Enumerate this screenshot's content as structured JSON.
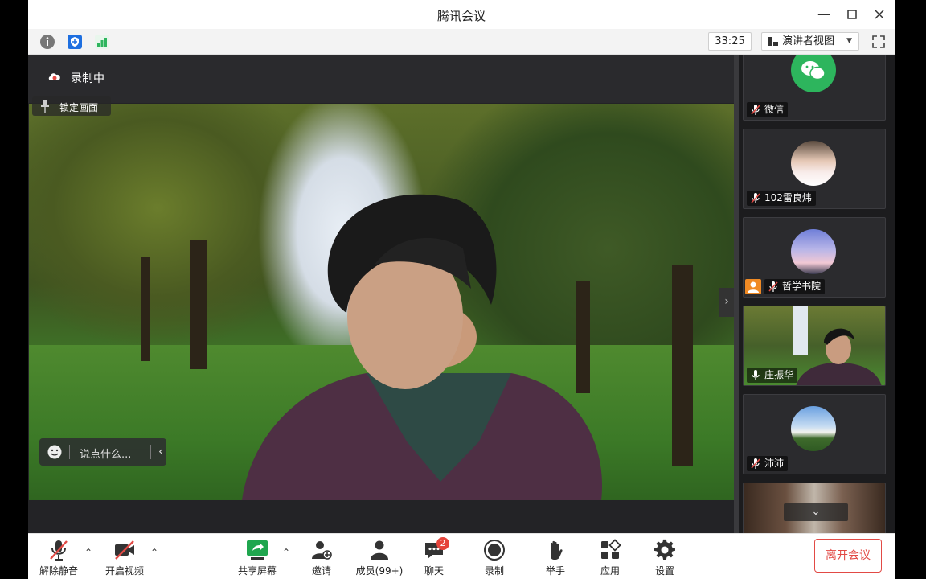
{
  "window": {
    "title": "腾讯会议"
  },
  "toolbar": {
    "timer": "33:25",
    "view_label": "演讲者视图"
  },
  "main": {
    "recording_label": "录制中",
    "lock_label": "锁定画面",
    "comment_placeholder": "说点什么..."
  },
  "participants": [
    {
      "name": "微信",
      "mic": "muted",
      "avatar": "wechat-logo"
    },
    {
      "name": "102雷良炜",
      "mic": "muted",
      "avatar": "portrait"
    },
    {
      "name": "哲学书院",
      "mic": "muted",
      "avatar": "sky",
      "host": true
    },
    {
      "name": "庄振华",
      "mic": "on",
      "avatar": "video"
    },
    {
      "name": "沛沛",
      "mic": "muted",
      "avatar": "landscape"
    }
  ],
  "bottombar": {
    "unmute": "解除静音",
    "start_video": "开启视频",
    "share_screen": "共享屏幕",
    "invite": "邀请",
    "members": "成员(99+)",
    "chat": "聊天",
    "chat_badge": "2",
    "record": "录制",
    "raise_hand": "举手",
    "apps": "应用",
    "settings": "设置",
    "leave": "离开会议"
  },
  "colors": {
    "accent_green": "#2db55d",
    "danger": "#e24a45",
    "dark_bg": "#1c1c1e"
  }
}
